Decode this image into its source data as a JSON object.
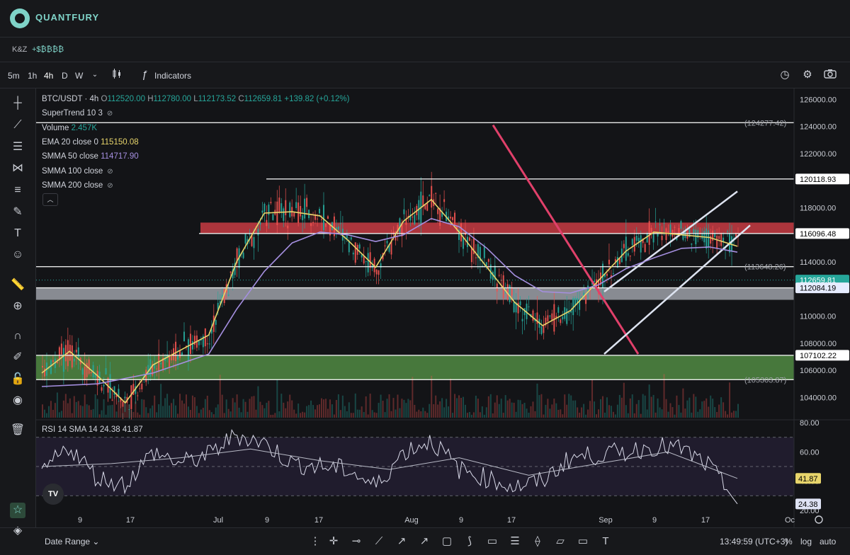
{
  "app": {
    "brand": "QUANTFURY"
  },
  "account": {
    "name": "K&Z",
    "balance": "+$₿₿₿₿"
  },
  "toolbar": {
    "timeframes": [
      "5m",
      "1h",
      "4h",
      "D",
      "W"
    ],
    "active_timeframe": "4h",
    "indicators_label": "Indicators"
  },
  "legend": {
    "symbol": "BTC/USDT · 4h",
    "o_label": "O",
    "o": "112520.00",
    "h_label": "H",
    "h": "112780.00",
    "l_label": "L",
    "l": "112173.52",
    "c_label": "C",
    "c": "112659.81",
    "change": "+139.82 (+0.12%)",
    "supertrend": "SuperTrend 10 3",
    "volume_label": "Volume",
    "volume": "2.457K",
    "ema_label": "EMA 20 close 0",
    "ema": "115150.08",
    "smma50_label": "SMMA 50 close",
    "smma50": "114717.90",
    "smma100_label": "SMMA 100 close",
    "smma200_label": "SMMA 200 close"
  },
  "rsi_legend": {
    "label": "RSI 14 SMA 14",
    "rsi": "24.38",
    "sma": "41.87"
  },
  "bottom": {
    "date_range": "Date Range",
    "clock": "13:49:59 (UTC+3)",
    "pct": "%",
    "log": "log",
    "auto": "auto"
  },
  "colors": {
    "up": "#26a69a",
    "down": "#ef5350",
    "ema": "#e8d56b",
    "smma": "#a58fe0",
    "resistance_zone": "#e0404a",
    "support_zone": "#5a9a4a",
    "grey_zone": "#9ea0a8",
    "trendline": "#e0406a",
    "channel": "#dde3f0"
  },
  "chart_data": [
    {
      "type": "line",
      "title": "BTC/USDT · 4h",
      "y_axis_ticks": [
        126000,
        124000,
        122000,
        120000,
        118000,
        116000,
        114000,
        112000,
        110000,
        108000,
        106000,
        104000
      ],
      "ylim": [
        102500,
        126800
      ],
      "x_tick_labels": [
        "9",
        "17",
        "Jul",
        "9",
        "17",
        "Aug",
        "9",
        "17",
        "Sep",
        "9",
        "17",
        "Oc"
      ],
      "series": [
        {
          "name": "EMA 20 close 0",
          "x": [
            0,
            4,
            8,
            12,
            16,
            20,
            24,
            28,
            32,
            36,
            40,
            44,
            48,
            52,
            56,
            60,
            64,
            68,
            72,
            76,
            80,
            84,
            88,
            92,
            96,
            100
          ],
          "values": [
            105800,
            107400,
            105600,
            103600,
            106400,
            107500,
            108600,
            114000,
            117600,
            117700,
            117400,
            115600,
            113600,
            117000,
            118600,
            116200,
            113600,
            111000,
            109300,
            110400,
            112600,
            114800,
            116200,
            116000,
            115800,
            115150
          ]
        },
        {
          "name": "SMMA 50 close",
          "x": [
            0,
            8,
            16,
            24,
            28,
            32,
            36,
            40,
            44,
            48,
            52,
            56,
            60,
            64,
            68,
            72,
            76,
            80,
            84,
            88,
            92,
            96,
            100
          ],
          "values": [
            104800,
            105000,
            105800,
            107200,
            110500,
            113300,
            115400,
            116200,
            116000,
            115500,
            116000,
            117200,
            116600,
            115000,
            113000,
            111800,
            111700,
            112300,
            113500,
            114300,
            115000,
            115100,
            114720
          ]
        }
      ],
      "price_labels": [
        "120118.93",
        "116096.48",
        "112659.81",
        "112084.19",
        "107102.22"
      ],
      "reference_labels": [
        "(124277.42)",
        "(113648.26)",
        "(105303.87)"
      ],
      "horizontal_levels": [
        124277.42,
        120118.93,
        116096.48,
        113648.26,
        112084.19,
        107102.22,
        105303.87
      ],
      "zones": [
        {
          "from": 116096.48,
          "to": 116900
        },
        {
          "from": 111200,
          "to": 112084.19
        },
        {
          "from": 105303.87,
          "to": 107102.22
        }
      ],
      "last_price": 112659.81
    },
    {
      "type": "line",
      "title": "RSI 14 SMA 14",
      "y_axis_ticks": [
        80,
        60,
        40,
        20
      ],
      "ylim": [
        18,
        82
      ],
      "series": [
        {
          "name": "RSI 14",
          "x": [
            0,
            4,
            8,
            12,
            16,
            20,
            24,
            28,
            32,
            36,
            40,
            44,
            48,
            52,
            56,
            60,
            64,
            68,
            72,
            76,
            80,
            84,
            88,
            92,
            96,
            100
          ],
          "values": [
            46,
            64,
            42,
            38,
            60,
            52,
            58,
            72,
            66,
            52,
            50,
            48,
            36,
            60,
            68,
            48,
            42,
            36,
            40,
            56,
            58,
            60,
            64,
            62,
            50,
            24.38
          ]
        },
        {
          "name": "SMA 14",
          "x": [
            0,
            10,
            20,
            30,
            40,
            50,
            60,
            70,
            80,
            90,
            100
          ],
          "values": [
            50,
            52,
            56,
            62,
            54,
            48,
            56,
            44,
            52,
            60,
            41.87
          ]
        }
      ],
      "levels": [
        70,
        50,
        30
      ],
      "current_labels": [
        "41.87",
        "24.38"
      ]
    }
  ]
}
